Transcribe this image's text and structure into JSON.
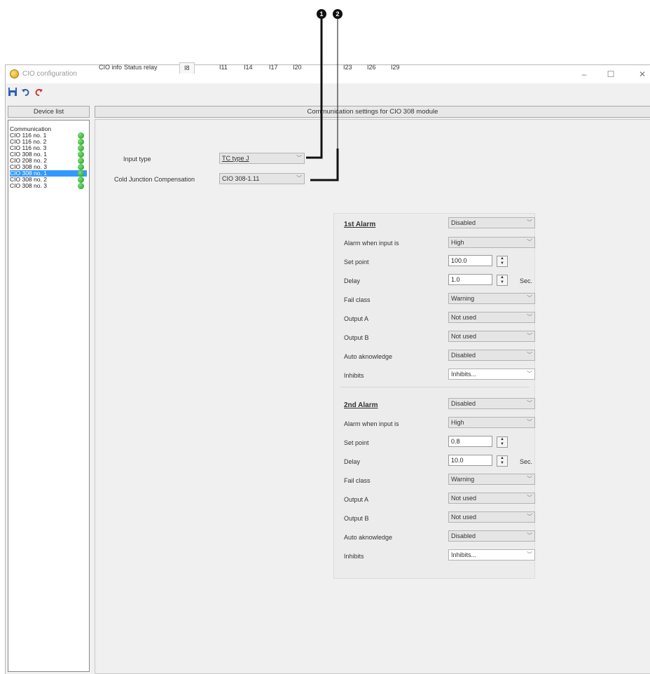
{
  "callouts": [
    "1",
    "2"
  ],
  "window": {
    "title": "CIO configuration",
    "controls": {
      "minimize": "–",
      "maximize": "☐",
      "close": "✕"
    }
  },
  "toolbar": {
    "icons": [
      "save-icon",
      "undo-icon",
      "redo-icon"
    ]
  },
  "device_list": {
    "header": "Device list",
    "items": [
      {
        "label": "Communication",
        "status": ""
      },
      {
        "label": "CIO 116 no. 1",
        "status": "ok"
      },
      {
        "label": "CIO 116 no. 2",
        "status": "ok"
      },
      {
        "label": "CIO 116 no. 3",
        "status": "ok"
      },
      {
        "label": "CIO 308 no. 1",
        "status": "ok"
      },
      {
        "label": "CIO 208 no. 2",
        "status": "ok"
      },
      {
        "label": "CIO 308 no. 3",
        "status": "ok"
      },
      {
        "label": "CIO 308 no. 1",
        "status": "ok",
        "selected": true
      },
      {
        "label": "CIO 308 no. 2",
        "status": "ok"
      },
      {
        "label": "CIO 308 no. 3",
        "status": "ok"
      }
    ]
  },
  "main": {
    "header": "Communication settings for CIO 308 module",
    "tabs": [
      "CIO info",
      "Status relay",
      "I8",
      "I11",
      "I14",
      "I17",
      "I20",
      "I23",
      "I26",
      "I29"
    ],
    "active_tab": "I8",
    "input_type": {
      "label": "Input type",
      "value": "TC type J"
    },
    "cjc": {
      "label": "Cold Junction Compensation",
      "value": "CIO 308-1.11"
    }
  },
  "alarms": [
    {
      "title": "1st Alarm",
      "state": "Disabled",
      "alarm_when_label": "Alarm when input is",
      "alarm_when": "High",
      "set_point_label": "Set point",
      "set_point": "100.0",
      "delay_label": "Delay",
      "delay": "1.0",
      "delay_unit": "Sec.",
      "fail_class_label": "Fail class",
      "fail_class": "Warning",
      "output_a_label": "Output A",
      "output_a": "Not used",
      "output_b_label": "Output B",
      "output_b": "Not used",
      "auto_ack_label": "Auto aknowledge",
      "auto_ack": "Disabled",
      "inhibits_label": "Inhibits",
      "inhibits": "Inhibits..."
    },
    {
      "title": "2nd Alarm",
      "state": "Disabled",
      "alarm_when_label": "Alarm when input is",
      "alarm_when": "High",
      "set_point_label": "Set point",
      "set_point": "0.8",
      "delay_label": "Delay",
      "delay": "10.0",
      "delay_unit": "Sec.",
      "fail_class_label": "Fail class",
      "fail_class": "Warning",
      "output_a_label": "Output A",
      "output_a": "Not used",
      "output_b_label": "Output B",
      "output_b": "Not used",
      "auto_ack_label": "Auto aknowledge",
      "auto_ack": "Disabled",
      "inhibits_label": "Inhibits",
      "inhibits": "Inhibits..."
    }
  ]
}
